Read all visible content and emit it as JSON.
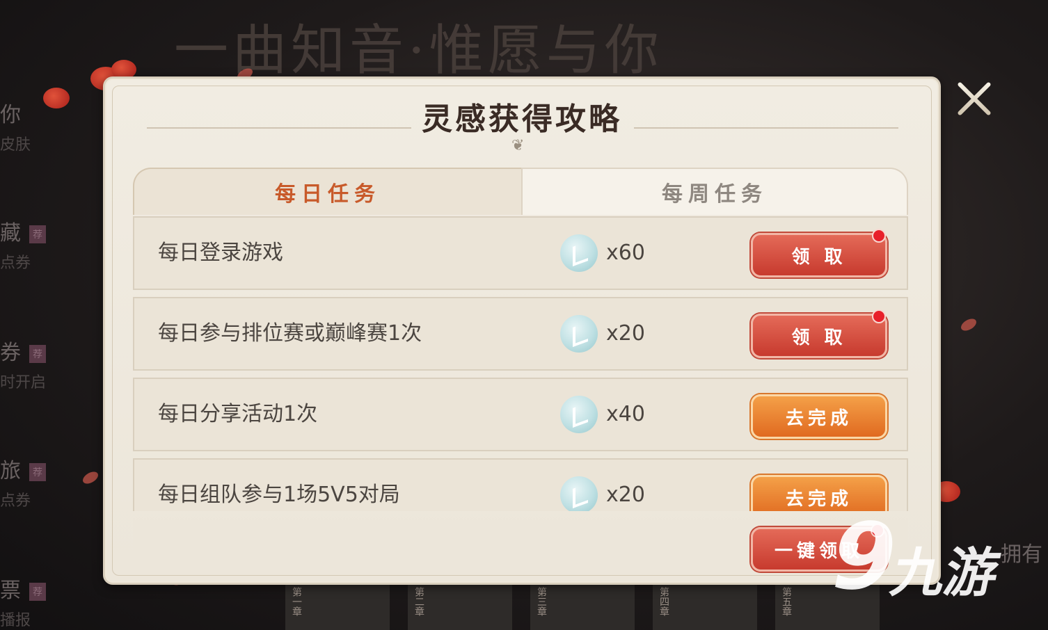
{
  "background": {
    "banner": "一曲知音·惟愿与你",
    "side_nav": [
      {
        "title": "你",
        "sub": "皮肤",
        "badge": ""
      },
      {
        "title": "藏",
        "sub": "点券",
        "badge": "荐"
      },
      {
        "title": "券",
        "sub": "时开启",
        "badge": "荐"
      },
      {
        "title": "旅",
        "sub": "点券",
        "badge": "荐"
      },
      {
        "title": "票",
        "sub": "播报",
        "badge": "荐"
      }
    ],
    "film_chapters": [
      "第一章",
      "第二章",
      "第三章",
      "第四章",
      "第五章"
    ],
    "right_edge": "拥有"
  },
  "dialog": {
    "title": "灵感获得攻略",
    "tabs": {
      "daily": "每日任务",
      "weekly": "每周任务",
      "active": "daily"
    },
    "tasks": [
      {
        "name": "每日登录游戏",
        "qty": "x60",
        "button": "领 取",
        "button_type": "claim",
        "dot": true
      },
      {
        "name": "每日参与排位赛或巅峰赛1次",
        "qty": "x20",
        "button": "领 取",
        "button_type": "claim",
        "dot": true
      },
      {
        "name": "每日分享活动1次",
        "qty": "x40",
        "button": "去完成",
        "button_type": "go",
        "dot": false
      },
      {
        "name": "每日组队参与1场5V5对局",
        "qty": "x20",
        "button": "去完成",
        "button_type": "go",
        "dot": false
      }
    ],
    "claim_all": "一键领取",
    "reward_icon": "inspiration-feather-icon"
  },
  "watermark": {
    "mark": "9",
    "text": "九游"
  },
  "colors": {
    "claim_button": "#d04a3a",
    "go_button": "#ea8230",
    "active_tab_text": "#c85a2a",
    "notification_dot": "#e8202a",
    "panel_bg": "#efe9de"
  }
}
